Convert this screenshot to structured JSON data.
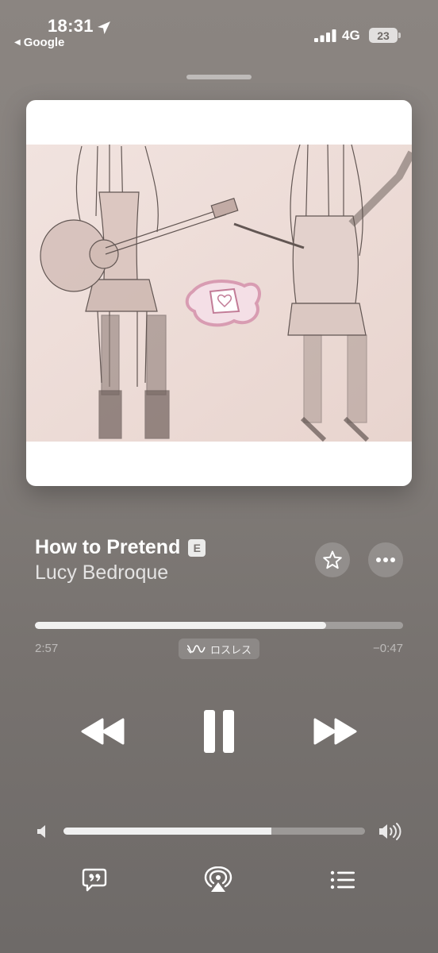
{
  "status_bar": {
    "time": "18:31",
    "back_app": "Google",
    "network": "4G",
    "battery": "23"
  },
  "now_playing": {
    "title": "How to Pretend",
    "explicit_badge": "E",
    "artist": "Lucy Bedroque",
    "elapsed": "2:57",
    "remaining": "−0:47",
    "progress_fraction": 0.79,
    "lossless_label": "ロスレス",
    "volume_fraction": 0.69
  },
  "icons": {
    "location": "location-arrow-icon",
    "signal": "cellular-signal-icon",
    "favorite": "star-icon",
    "more": "ellipsis-icon",
    "lossless": "lossless-wave-icon",
    "rewind": "rewind-icon",
    "pause": "pause-icon",
    "forward": "fast-forward-icon",
    "volume_low": "speaker-low-icon",
    "volume_high": "speaker-high-icon",
    "lyrics": "lyrics-quote-icon",
    "airplay": "airplay-icon",
    "queue": "queue-list-icon"
  },
  "colors": {
    "background": "#85807c",
    "artwork_paper": "#efe0dc",
    "explicit_badge_bg": "#d9d6d4"
  }
}
